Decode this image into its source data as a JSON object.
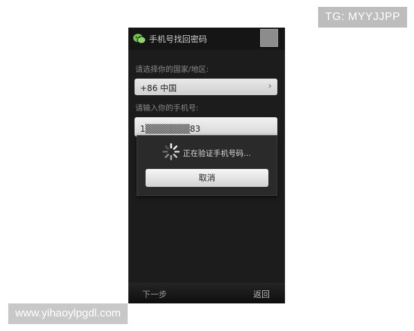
{
  "watermarks": {
    "top": "TG: MYYJJPP",
    "bottom": "www.yihaoylpgdl.com"
  },
  "titlebar": {
    "title": "手机号找回密码",
    "logo_icon": "wechat-logo-icon"
  },
  "form": {
    "country_label": "请选择你的国家/地区:",
    "country_value": "+86  中国",
    "phone_label": "请输入你的手机号:",
    "phone_value": "1▒▒▒▒▒▒▒83"
  },
  "dialog": {
    "message": "正在验证手机号码...",
    "cancel_label": "取消"
  },
  "bottombar": {
    "next_label": "下一步",
    "back_label": "返回"
  },
  "colors": {
    "screen_bg": "#1c1c1c",
    "button_light": "#e5e5e5"
  }
}
